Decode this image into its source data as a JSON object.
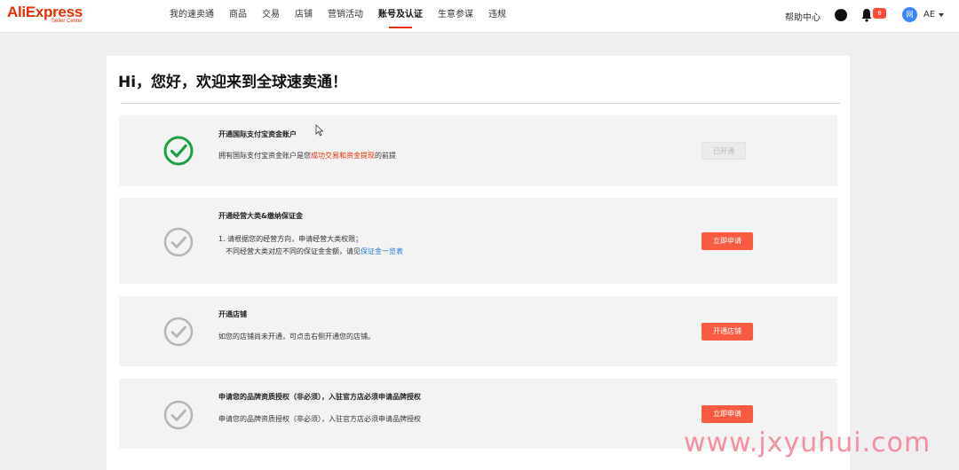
{
  "header": {
    "logo_main": "AliExpress",
    "logo_sub": "Seller Center",
    "nav": [
      "我的速卖通",
      "商品",
      "交易",
      "店铺",
      "营销活动",
      "账号及认证",
      "生意参谋",
      "违规"
    ],
    "help": "帮助中心",
    "notification_count": "6",
    "avatar_text": "网",
    "user_code": "AE",
    "accent": "#e62e04"
  },
  "main": {
    "welcome": "Hi，您好，欢迎来到全球速卖通！",
    "steps": [
      {
        "title": "开通国际支付宝资金账户",
        "desc_pre": "拥有国际支付宝资金账户是您",
        "desc_hl": "成功交易和资金提现",
        "desc_post": "的前提",
        "status": "done",
        "button": "已开通"
      },
      {
        "title": "开通经营大类&缴纳保证金",
        "desc_line1": "1. 请根据您的经营方向，申请经营大类权限；",
        "desc_line2_pre": "不同经营大类对应不同的保证金金额，请见",
        "desc_line2_link": "保证金一览表",
        "status": "pending",
        "button": "立即申请"
      },
      {
        "title": "开通店铺",
        "desc": "如您的店铺尚未开通，可点击右侧开通您的店铺。",
        "status": "pending",
        "button": "开通店铺"
      },
      {
        "title": "申请您的品牌资质授权（非必须），入驻官方店必须申请品牌授权",
        "desc": "申请您的品牌资质授权（非必须），入驻官方店必须申请品牌授权",
        "status": "pending",
        "button": "立即申请"
      }
    ]
  },
  "watermark": "www.jxyuhui.com"
}
